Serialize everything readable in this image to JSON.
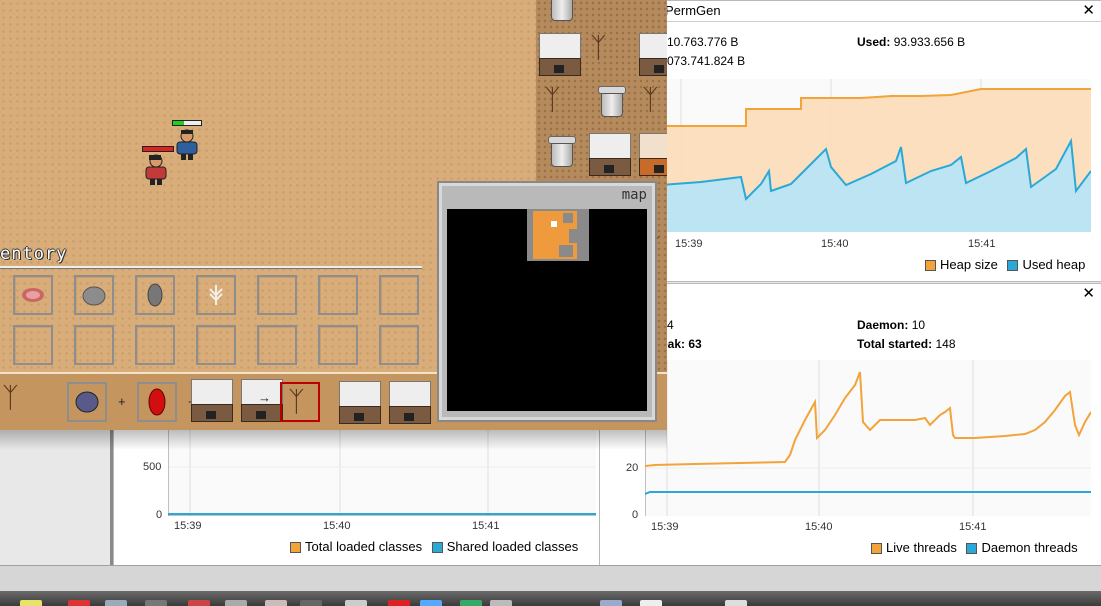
{
  "monitor": {
    "heap": {
      "title": "PermGen",
      "size_label": "10.763.776 B",
      "max_label": "073.741.824 B",
      "used_key": "Used:",
      "used_value": "93.933.656 B",
      "times": [
        "15:39",
        "15:40",
        "15:41"
      ],
      "legend": [
        "Heap size",
        "Used heap"
      ]
    },
    "threads": {
      "live_partial": "4",
      "peak_partial": "eak: 63",
      "daemon_key": "Daemon:",
      "daemon_value": "10",
      "started_key": "Total started:",
      "started_value": "148",
      "ytick": "20",
      "yzero": "0",
      "times": [
        "15:39",
        "15:40",
        "15:41"
      ],
      "legend": [
        "Live threads",
        "Daemon threads"
      ]
    },
    "classes": {
      "ytick": "500",
      "yzero": "0",
      "times": [
        "15:39",
        "15:40",
        "15:41"
      ],
      "legend": [
        "Total loaded classes",
        "Shared loaded classes"
      ]
    },
    "colors": {
      "orange": "#f2a33a",
      "blue": "#2aa9d6"
    }
  },
  "game": {
    "inventory_title": "entory",
    "map_title": "map",
    "hotbar_signs": [
      "+",
      "+",
      "−",
      "→"
    ],
    "inventory_items": [
      "meat-icon",
      "stone-icon",
      "flint-icon",
      "wheat-icon"
    ]
  }
}
